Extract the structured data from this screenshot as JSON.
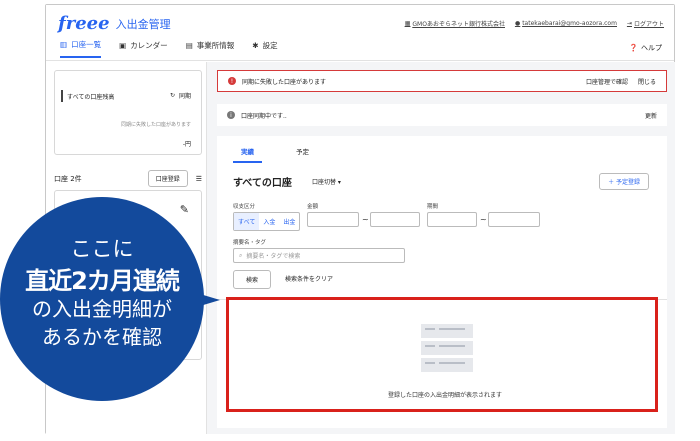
{
  "app": {
    "logo": "freee",
    "title": "入出金管理"
  },
  "header": {
    "bank_link": "GMOあおぞらネット銀行株式会社",
    "user_email": "tatekaebarai@gmo-aozora.com",
    "logout": "ログアウト",
    "help": "ヘルプ"
  },
  "nav": {
    "items": [
      {
        "label": "口座一覧"
      },
      {
        "label": "カレンダー"
      },
      {
        "label": "事業所情報"
      },
      {
        "label": "設定"
      }
    ]
  },
  "sidebar": {
    "balance_card": {
      "title": "すべての口座残高",
      "sync": "同期",
      "fail_note": "同期に失敗した口座があります",
      "amount": "-円"
    },
    "accounts_count": "口座 2件",
    "register_button": "口座登録"
  },
  "main": {
    "alert": {
      "text": "同期に失敗した口座があります",
      "confirm": "口座管理で確認",
      "close": "閉じる"
    },
    "syncing": {
      "text": "口座同期中です..",
      "refresh": "更新"
    },
    "tabs": [
      {
        "label": "実績"
      },
      {
        "label": "予定"
      }
    ],
    "title": "すべての口座",
    "switch": "口座切替 ▾",
    "plan_button": "＋ 予定登録",
    "filters": {
      "type_label": "収支区分",
      "type_options": [
        "すべて",
        "入金",
        "出金"
      ],
      "amount_label": "金額",
      "date_label": "期間",
      "summary_label": "摘要名・タグ",
      "search_placeholder": "摘要名・タグで検索",
      "search_button": "検索",
      "clear_button": "検索条件をクリア"
    },
    "empty_text": "登録した口座の入出金明細が表示されます"
  },
  "callout": {
    "line1": "ここに",
    "line2": "直近2カ月連続",
    "line3": "の入出金明細が",
    "line4": "あるかを確認"
  },
  "colors": {
    "accent": "#2864f0",
    "alert": "#d53a3a",
    "callout": "#134a9c",
    "highlight": "#d9211b"
  }
}
